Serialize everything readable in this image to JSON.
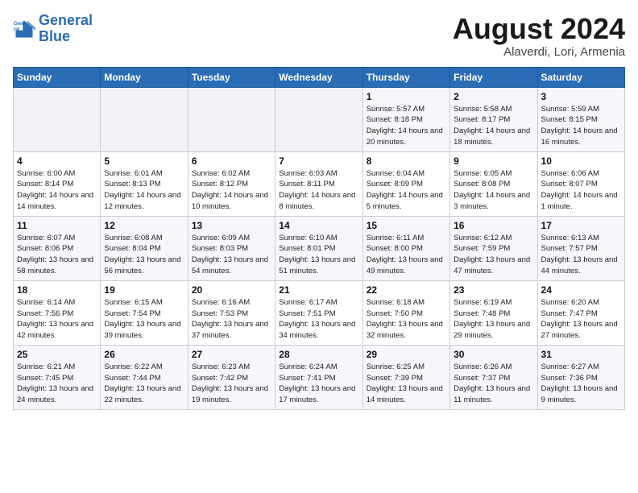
{
  "logo": {
    "line1": "General",
    "line2": "Blue"
  },
  "title": "August 2024",
  "subtitle": "Alaverdi, Lori, Armenia",
  "header_days": [
    "Sunday",
    "Monday",
    "Tuesday",
    "Wednesday",
    "Thursday",
    "Friday",
    "Saturday"
  ],
  "weeks": [
    [
      {
        "day": "",
        "sunrise": "",
        "sunset": "",
        "daylight": ""
      },
      {
        "day": "",
        "sunrise": "",
        "sunset": "",
        "daylight": ""
      },
      {
        "day": "",
        "sunrise": "",
        "sunset": "",
        "daylight": ""
      },
      {
        "day": "",
        "sunrise": "",
        "sunset": "",
        "daylight": ""
      },
      {
        "day": "1",
        "sunrise": "Sunrise: 5:57 AM",
        "sunset": "Sunset: 8:18 PM",
        "daylight": "Daylight: 14 hours and 20 minutes."
      },
      {
        "day": "2",
        "sunrise": "Sunrise: 5:58 AM",
        "sunset": "Sunset: 8:17 PM",
        "daylight": "Daylight: 14 hours and 18 minutes."
      },
      {
        "day": "3",
        "sunrise": "Sunrise: 5:59 AM",
        "sunset": "Sunset: 8:15 PM",
        "daylight": "Daylight: 14 hours and 16 minutes."
      }
    ],
    [
      {
        "day": "4",
        "sunrise": "Sunrise: 6:00 AM",
        "sunset": "Sunset: 8:14 PM",
        "daylight": "Daylight: 14 hours and 14 minutes."
      },
      {
        "day": "5",
        "sunrise": "Sunrise: 6:01 AM",
        "sunset": "Sunset: 8:13 PM",
        "daylight": "Daylight: 14 hours and 12 minutes."
      },
      {
        "day": "6",
        "sunrise": "Sunrise: 6:02 AM",
        "sunset": "Sunset: 8:12 PM",
        "daylight": "Daylight: 14 hours and 10 minutes."
      },
      {
        "day": "7",
        "sunrise": "Sunrise: 6:03 AM",
        "sunset": "Sunset: 8:11 PM",
        "daylight": "Daylight: 14 hours and 8 minutes."
      },
      {
        "day": "8",
        "sunrise": "Sunrise: 6:04 AM",
        "sunset": "Sunset: 8:09 PM",
        "daylight": "Daylight: 14 hours and 5 minutes."
      },
      {
        "day": "9",
        "sunrise": "Sunrise: 6:05 AM",
        "sunset": "Sunset: 8:08 PM",
        "daylight": "Daylight: 14 hours and 3 minutes."
      },
      {
        "day": "10",
        "sunrise": "Sunrise: 6:06 AM",
        "sunset": "Sunset: 8:07 PM",
        "daylight": "Daylight: 14 hours and 1 minute."
      }
    ],
    [
      {
        "day": "11",
        "sunrise": "Sunrise: 6:07 AM",
        "sunset": "Sunset: 8:06 PM",
        "daylight": "Daylight: 13 hours and 58 minutes."
      },
      {
        "day": "12",
        "sunrise": "Sunrise: 6:08 AM",
        "sunset": "Sunset: 8:04 PM",
        "daylight": "Daylight: 13 hours and 56 minutes."
      },
      {
        "day": "13",
        "sunrise": "Sunrise: 6:09 AM",
        "sunset": "Sunset: 8:03 PM",
        "daylight": "Daylight: 13 hours and 54 minutes."
      },
      {
        "day": "14",
        "sunrise": "Sunrise: 6:10 AM",
        "sunset": "Sunset: 8:01 PM",
        "daylight": "Daylight: 13 hours and 51 minutes."
      },
      {
        "day": "15",
        "sunrise": "Sunrise: 6:11 AM",
        "sunset": "Sunset: 8:00 PM",
        "daylight": "Daylight: 13 hours and 49 minutes."
      },
      {
        "day": "16",
        "sunrise": "Sunrise: 6:12 AM",
        "sunset": "Sunset: 7:59 PM",
        "daylight": "Daylight: 13 hours and 47 minutes."
      },
      {
        "day": "17",
        "sunrise": "Sunrise: 6:13 AM",
        "sunset": "Sunset: 7:57 PM",
        "daylight": "Daylight: 13 hours and 44 minutes."
      }
    ],
    [
      {
        "day": "18",
        "sunrise": "Sunrise: 6:14 AM",
        "sunset": "Sunset: 7:56 PM",
        "daylight": "Daylight: 13 hours and 42 minutes."
      },
      {
        "day": "19",
        "sunrise": "Sunrise: 6:15 AM",
        "sunset": "Sunset: 7:54 PM",
        "daylight": "Daylight: 13 hours and 39 minutes."
      },
      {
        "day": "20",
        "sunrise": "Sunrise: 6:16 AM",
        "sunset": "Sunset: 7:53 PM",
        "daylight": "Daylight: 13 hours and 37 minutes."
      },
      {
        "day": "21",
        "sunrise": "Sunrise: 6:17 AM",
        "sunset": "Sunset: 7:51 PM",
        "daylight": "Daylight: 13 hours and 34 minutes."
      },
      {
        "day": "22",
        "sunrise": "Sunrise: 6:18 AM",
        "sunset": "Sunset: 7:50 PM",
        "daylight": "Daylight: 13 hours and 32 minutes."
      },
      {
        "day": "23",
        "sunrise": "Sunrise: 6:19 AM",
        "sunset": "Sunset: 7:48 PM",
        "daylight": "Daylight: 13 hours and 29 minutes."
      },
      {
        "day": "24",
        "sunrise": "Sunrise: 6:20 AM",
        "sunset": "Sunset: 7:47 PM",
        "daylight": "Daylight: 13 hours and 27 minutes."
      }
    ],
    [
      {
        "day": "25",
        "sunrise": "Sunrise: 6:21 AM",
        "sunset": "Sunset: 7:45 PM",
        "daylight": "Daylight: 13 hours and 24 minutes."
      },
      {
        "day": "26",
        "sunrise": "Sunrise: 6:22 AM",
        "sunset": "Sunset: 7:44 PM",
        "daylight": "Daylight: 13 hours and 22 minutes."
      },
      {
        "day": "27",
        "sunrise": "Sunrise: 6:23 AM",
        "sunset": "Sunset: 7:42 PM",
        "daylight": "Daylight: 13 hours and 19 minutes."
      },
      {
        "day": "28",
        "sunrise": "Sunrise: 6:24 AM",
        "sunset": "Sunset: 7:41 PM",
        "daylight": "Daylight: 13 hours and 17 minutes."
      },
      {
        "day": "29",
        "sunrise": "Sunrise: 6:25 AM",
        "sunset": "Sunset: 7:39 PM",
        "daylight": "Daylight: 13 hours and 14 minutes."
      },
      {
        "day": "30",
        "sunrise": "Sunrise: 6:26 AM",
        "sunset": "Sunset: 7:37 PM",
        "daylight": "Daylight: 13 hours and 11 minutes."
      },
      {
        "day": "31",
        "sunrise": "Sunrise: 6:27 AM",
        "sunset": "Sunset: 7:36 PM",
        "daylight": "Daylight: 13 hours and 9 minutes."
      }
    ]
  ]
}
